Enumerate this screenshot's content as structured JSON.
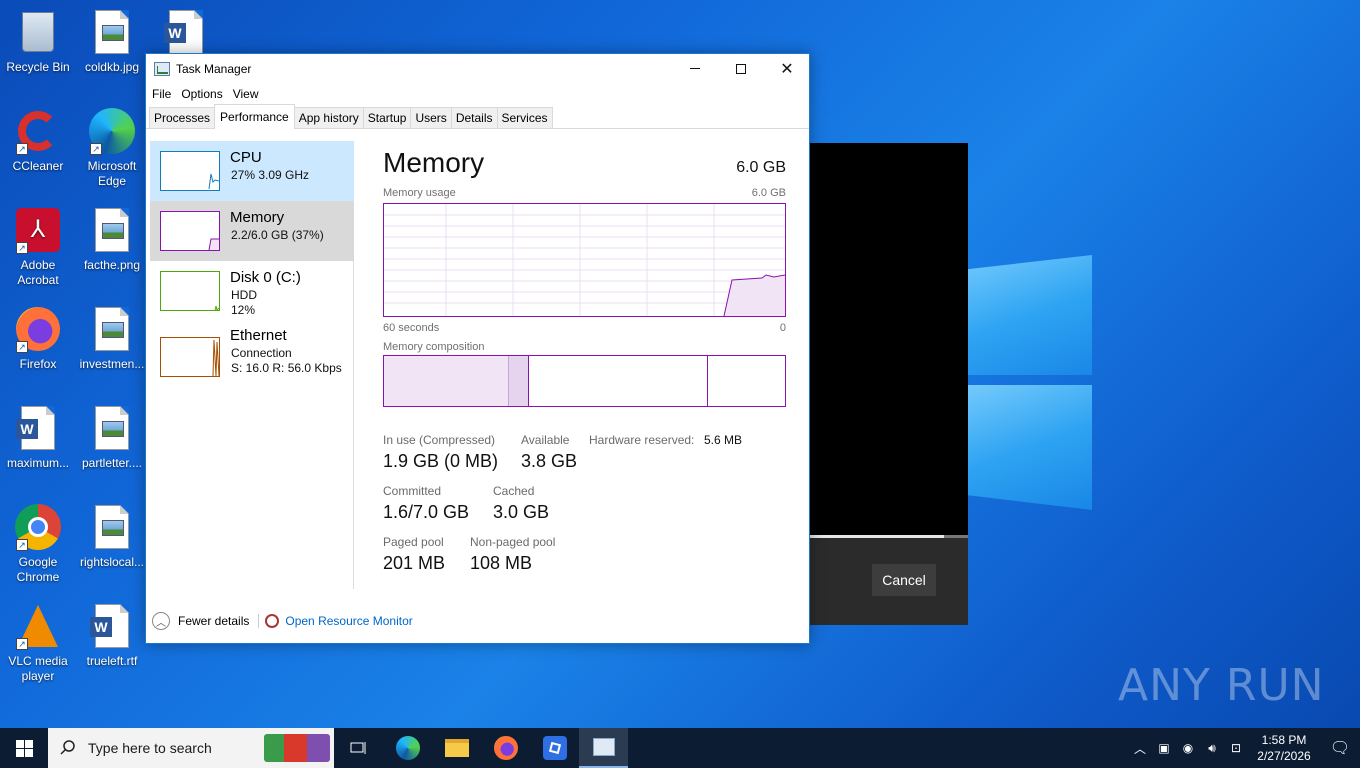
{
  "desktop": {
    "icons": [
      {
        "label": "Recycle Bin"
      },
      {
        "label": "coldkb.jpg"
      },
      {
        "label": "CCleaner"
      },
      {
        "label": "Microsoft Edge"
      },
      {
        "label": "Adobe Acrobat"
      },
      {
        "label": "facthe.png"
      },
      {
        "label": "Firefox"
      },
      {
        "label": "investmen..."
      },
      {
        "label": "maximum..."
      },
      {
        "label": "partletter...."
      },
      {
        "label": "Google Chrome"
      },
      {
        "label": "rightslocal..."
      },
      {
        "label": "VLC media player"
      },
      {
        "label": "trueleft.rtf"
      }
    ],
    "watermark": "ANY RUN"
  },
  "bg_dialog": {
    "cancel_label": "Cancel"
  },
  "taskmanager": {
    "title": "Task Manager",
    "menu": [
      "File",
      "Options",
      "View"
    ],
    "tabs": [
      "Processes",
      "Performance",
      "App history",
      "Startup",
      "Users",
      "Details",
      "Services"
    ],
    "active_tab": "Performance",
    "sidebar": {
      "cpu": {
        "name": "CPU",
        "detail": "27%  3.09 GHz"
      },
      "memory": {
        "name": "Memory",
        "detail": "2.2/6.0 GB (37%)"
      },
      "disk": {
        "name": "Disk 0 (C:)",
        "detail1": "HDD",
        "detail2": "12%"
      },
      "ethernet": {
        "name": "Ethernet",
        "detail1": "Connection",
        "detail2": "S: 16.0  R: 56.0 Kbps"
      }
    },
    "memory": {
      "title": "Memory",
      "total": "6.0 GB",
      "usage_label": "Memory usage",
      "usage_max": "6.0 GB",
      "time_label": "60 seconds",
      "time_zero": "0",
      "composition_label": "Memory composition",
      "in_use_label": "In use (Compressed)",
      "in_use_value": "1.9 GB (0 MB)",
      "available_label": "Available",
      "available_value": "3.8 GB",
      "hw_reserved_label": "Hardware reserved:",
      "hw_reserved_value": "5.6 MB",
      "committed_label": "Committed",
      "committed_value": "1.6/7.0 GB",
      "cached_label": "Cached",
      "cached_value": "3.0 GB",
      "paged_label": "Paged pool",
      "paged_value": "201 MB",
      "nonpaged_label": "Non-paged pool",
      "nonpaged_value": "108 MB"
    },
    "footer": {
      "fewer": "Fewer details",
      "resmon": "Open Resource Monitor"
    }
  },
  "taskbar": {
    "search_placeholder": "Type here to search",
    "time": "1:58 PM",
    "date": "2/27/2026"
  }
}
